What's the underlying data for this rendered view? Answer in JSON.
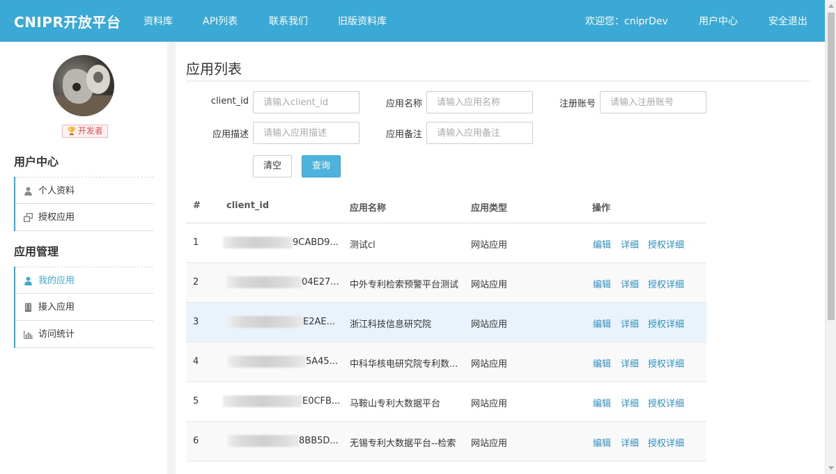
{
  "header": {
    "brand": "CNIPR开放平台",
    "nav": [
      "资料库",
      "API列表",
      "联系我们",
      "旧版资料库"
    ],
    "welcome": "欢迎您：cniprDev",
    "user_center": "用户中心",
    "logout": "安全退出",
    "bg_color": "#3ba9d5"
  },
  "sidebar": {
    "badge": "开发者",
    "sections": [
      {
        "title": "用户中心",
        "items": [
          {
            "label": "个人资料",
            "icon": "user-icon",
            "active": false
          },
          {
            "label": "授权应用",
            "icon": "windows-icon",
            "active": false
          }
        ]
      },
      {
        "title": "应用管理",
        "items": [
          {
            "label": "我的应用",
            "icon": "user-icon",
            "active": true
          },
          {
            "label": "接入应用",
            "icon": "building-icon",
            "active": false
          },
          {
            "label": "访问统计",
            "icon": "bar-chart-icon",
            "active": false
          }
        ]
      }
    ],
    "accent_color": "#3ba9d5"
  },
  "main": {
    "title": "应用列表",
    "filters": {
      "client_id": {
        "label": "client_id",
        "placeholder": "请输入client_id",
        "value": ""
      },
      "app_name": {
        "label": "应用名称",
        "placeholder": "请输入应用名称",
        "value": ""
      },
      "account": {
        "label": "注册账号",
        "placeholder": "请输入注册账号",
        "value": ""
      },
      "app_desc": {
        "label": "应用描述",
        "placeholder": "请输入应用描述",
        "value": ""
      },
      "app_remark": {
        "label": "应用备注",
        "placeholder": "请输入应用备注",
        "value": ""
      }
    },
    "buttons": {
      "clear": "清空",
      "query": "查询"
    },
    "table": {
      "headers": [
        "#",
        "client_id",
        "应用名称",
        "应用类型",
        "操作"
      ],
      "rows": [
        {
          "num": "1",
          "client_id_visible": "9CABD9...",
          "name": "测试cl",
          "type": "网站应用"
        },
        {
          "num": "2",
          "client_id_visible": "04E27...",
          "name": "中外专利检索预警平台测试",
          "type": "网站应用"
        },
        {
          "num": "3",
          "client_id_visible": "E2AE...",
          "name": "浙江科技信息研究院",
          "type": "网站应用"
        },
        {
          "num": "4",
          "client_id_visible": "5A45...",
          "name": "中科华核电研究院专利数...",
          "type": "网站应用"
        },
        {
          "num": "5",
          "client_id_visible": "E0CFB...",
          "name": "马鞍山专利大数据平台",
          "type": "网站应用"
        },
        {
          "num": "6",
          "client_id_visible": "8BB5D...",
          "name": "无锡专利大数据平台--检索",
          "type": "网站应用"
        }
      ],
      "actions": {
        "edit": "编辑",
        "detail": "详细",
        "auth_detail": "授权详细"
      }
    }
  }
}
